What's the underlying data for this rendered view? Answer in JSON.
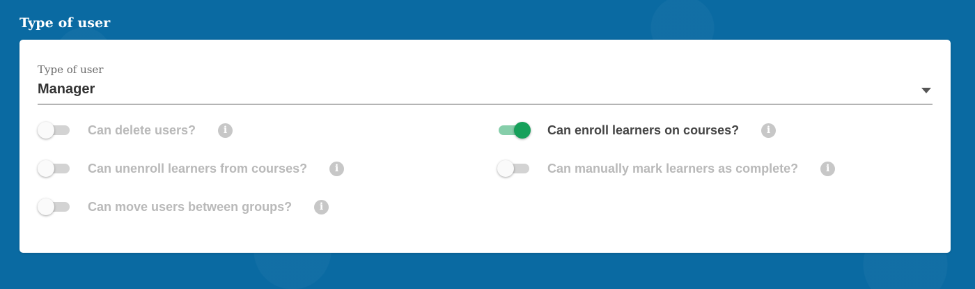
{
  "section": {
    "title": "Type of user"
  },
  "user_type_select": {
    "label": "Type of user",
    "selected": "Manager"
  },
  "permissions": [
    {
      "label": "Can delete users?",
      "enabled": false,
      "info_icon": "i"
    },
    {
      "label": "Can enroll learners on courses?",
      "enabled": true,
      "info_icon": "i"
    },
    {
      "label": "Can unenroll learners from courses?",
      "enabled": false,
      "info_icon": "i"
    },
    {
      "label": "Can manually mark learners as complete?",
      "enabled": false,
      "info_icon": "i"
    },
    {
      "label": "Can move users between groups?",
      "enabled": false,
      "info_icon": "i"
    }
  ],
  "colors": {
    "background": "#0a6aa2",
    "toggle_on": "#16a05a",
    "toggle_on_track": "#86ceaa",
    "toggle_off_track": "#d3d3d3",
    "disabled_text": "#b9b9b9",
    "active_text": "#444444"
  }
}
